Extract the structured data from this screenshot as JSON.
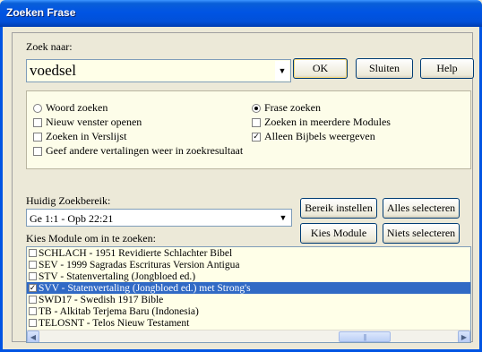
{
  "window": {
    "title": "Zoeken Frase"
  },
  "search": {
    "label": "Zoek naar:",
    "value": "voedsel"
  },
  "buttons": {
    "ok": "OK",
    "close": "Sluiten",
    "help": "Help",
    "set_range": "Bereik instellen",
    "select_all": "Alles selecteren",
    "choose_module": "Kies Module",
    "select_none": "Niets selecteren"
  },
  "options": {
    "word_search": {
      "label": "Woord zoeken",
      "checked": false
    },
    "phrase_search": {
      "label": "Frase zoeken",
      "checked": true
    },
    "new_window": {
      "label": "Nieuw venster openen",
      "checked": false
    },
    "multi_modules": {
      "label": "Zoeken in meerdere Modules",
      "checked": false
    },
    "in_verse_list": {
      "label": "Zoeken in Verslijst",
      "checked": false
    },
    "bibles_only": {
      "label": "Alleen Bijbels weergeven",
      "checked": true
    },
    "other_translations": {
      "label": "Geef andere vertalingen weer in zoekresultaat",
      "checked": false
    }
  },
  "range": {
    "label": "Huidig Zoekbereik:",
    "value": "Ge 1:1 - Opb 22:21"
  },
  "modules": {
    "label": "Kies Module om in te zoeken:",
    "items": [
      {
        "text": "SCHLACH - 1951 Revidierte Schlachter Bibel",
        "checked": false,
        "selected": false
      },
      {
        "text": "SEV - 1999 Sagradas Escrituras Version Antigua",
        "checked": false,
        "selected": false
      },
      {
        "text": "STV - Statenvertaling (Jongbloed ed.)",
        "checked": false,
        "selected": false
      },
      {
        "text": "SVV - Statenvertaling (Jongbloed ed.) met Strong's",
        "checked": true,
        "selected": true
      },
      {
        "text": "SWD17 - Swedish 1917 Bible",
        "checked": false,
        "selected": false
      },
      {
        "text": "TB - Alkitab Terjema Baru (Indonesia)",
        "checked": false,
        "selected": false
      },
      {
        "text": "TELOSNT - Telos Nieuw Testament",
        "checked": false,
        "selected": false
      }
    ]
  },
  "icons": {
    "dropdown": "chevron-down-icon",
    "scroll_left": "chevron-left-icon",
    "scroll_right": "chevron-right-icon"
  },
  "colors": {
    "title_bar": "#0054e3",
    "selection": "#316ac5",
    "field_background": "#ffffe8"
  }
}
